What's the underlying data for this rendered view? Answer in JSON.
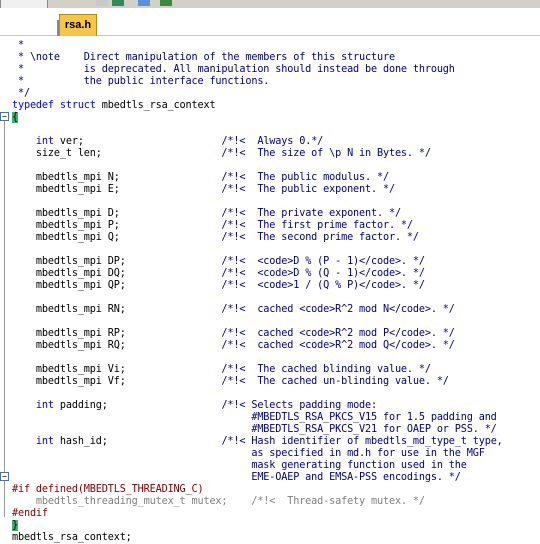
{
  "toolbar": {
    "icons": [
      "toolbar-icon-a",
      "download-arrow-icon",
      "filter-icon",
      "image-check-icon"
    ]
  },
  "tab": {
    "label": "rsa.h"
  },
  "code": {
    "lines": [
      {
        "text": " *",
        "cls": "c"
      },
      {
        "text": " * \\note    Direct manipulation of the members of this structure",
        "cls": "c"
      },
      {
        "text": " *          is deprecated. All manipulation should instead be done through",
        "cls": "c"
      },
      {
        "text": " *          the public interface functions.",
        "cls": "c"
      },
      {
        "text": " */",
        "cls": "c"
      },
      {
        "segments": [
          {
            "t": "typedef struct",
            "cls": "kw"
          },
          {
            "t": " mbedtls_rsa_context",
            "cls": ""
          }
        ]
      },
      {
        "text": "{",
        "cls": "brace"
      },
      {
        "text": "",
        "cls": ""
      },
      {
        "segments": [
          {
            "t": "    int",
            "cls": "kw"
          },
          {
            "t": " ver;                       ",
            "cls": ""
          },
          {
            "t": "/*!<  Always 0.*/",
            "cls": "c"
          }
        ]
      },
      {
        "segments": [
          {
            "t": "    size_t len;                    ",
            "cls": ""
          },
          {
            "t": "/*!<  The size of \\p N in Bytes. */",
            "cls": "c"
          }
        ]
      },
      {
        "text": "",
        "cls": ""
      },
      {
        "segments": [
          {
            "t": "    mbedtls_mpi N;                 ",
            "cls": ""
          },
          {
            "t": "/*!<  The public modulus. */",
            "cls": "c"
          }
        ]
      },
      {
        "segments": [
          {
            "t": "    mbedtls_mpi E;                 ",
            "cls": ""
          },
          {
            "t": "/*!<  The public exponent. */",
            "cls": "c"
          }
        ]
      },
      {
        "text": "",
        "cls": ""
      },
      {
        "segments": [
          {
            "t": "    mbedtls_mpi D;                 ",
            "cls": ""
          },
          {
            "t": "/*!<  The private exponent. */",
            "cls": "c"
          }
        ]
      },
      {
        "segments": [
          {
            "t": "    mbedtls_mpi P;                 ",
            "cls": ""
          },
          {
            "t": "/*!<  The first prime factor. */",
            "cls": "c"
          }
        ]
      },
      {
        "segments": [
          {
            "t": "    mbedtls_mpi Q;                 ",
            "cls": ""
          },
          {
            "t": "/*!<  The second prime factor. */",
            "cls": "c"
          }
        ]
      },
      {
        "text": "",
        "cls": ""
      },
      {
        "segments": [
          {
            "t": "    mbedtls_mpi DP;                ",
            "cls": ""
          },
          {
            "t": "/*!<  <code>D % (P - 1)</code>. */",
            "cls": "c"
          }
        ]
      },
      {
        "segments": [
          {
            "t": "    mbedtls_mpi DQ;                ",
            "cls": ""
          },
          {
            "t": "/*!<  <code>D % (Q - 1)</code>. */",
            "cls": "c"
          }
        ]
      },
      {
        "segments": [
          {
            "t": "    mbedtls_mpi QP;                ",
            "cls": ""
          },
          {
            "t": "/*!<  <code>1 / (Q % P)</code>. */",
            "cls": "c"
          }
        ]
      },
      {
        "text": "",
        "cls": ""
      },
      {
        "segments": [
          {
            "t": "    mbedtls_mpi RN;                ",
            "cls": ""
          },
          {
            "t": "/*!<  cached <code>R^2 mod N</code>. */",
            "cls": "c"
          }
        ]
      },
      {
        "text": "",
        "cls": ""
      },
      {
        "segments": [
          {
            "t": "    mbedtls_mpi RP;                ",
            "cls": ""
          },
          {
            "t": "/*!<  cached <code>R^2 mod P</code>. */",
            "cls": "c"
          }
        ]
      },
      {
        "segments": [
          {
            "t": "    mbedtls_mpi RQ;                ",
            "cls": ""
          },
          {
            "t": "/*!<  cached <code>R^2 mod Q</code>. */",
            "cls": "c"
          }
        ]
      },
      {
        "text": "",
        "cls": ""
      },
      {
        "segments": [
          {
            "t": "    mbedtls_mpi Vi;                ",
            "cls": ""
          },
          {
            "t": "/*!<  The cached blinding value. */",
            "cls": "c"
          }
        ]
      },
      {
        "segments": [
          {
            "t": "    mbedtls_mpi Vf;                ",
            "cls": ""
          },
          {
            "t": "/*!<  The cached un-blinding value. */",
            "cls": "c"
          }
        ]
      },
      {
        "text": "",
        "cls": ""
      },
      {
        "segments": [
          {
            "t": "    int",
            "cls": "kw"
          },
          {
            "t": " padding;                   ",
            "cls": ""
          },
          {
            "t": "/*!< Selects padding mode:",
            "cls": "c"
          }
        ]
      },
      {
        "text": "                                        #MBEDTLS_RSA_PKCS_V15 for 1.5 padding and",
        "cls": "c"
      },
      {
        "text": "                                        #MBEDTLS_RSA_PKCS_V21 for OAEP or PSS. */",
        "cls": "c"
      },
      {
        "segments": [
          {
            "t": "    int",
            "cls": "kw"
          },
          {
            "t": " hash_id;                   ",
            "cls": ""
          },
          {
            "t": "/*!< Hash identifier of mbedtls_md_type_t type,",
            "cls": "c"
          }
        ]
      },
      {
        "text": "                                        as specified in md.h for use in the MGF",
        "cls": "c"
      },
      {
        "text": "                                        mask generating function used in the",
        "cls": "c"
      },
      {
        "text": "                                        EME-OAEP and EMSA-PSS encodings. */",
        "cls": "c"
      },
      {
        "text": "#if defined(MBEDTLS_THREADING_C)",
        "cls": "pp"
      },
      {
        "text": "    mbedtls_threading_mutex_t mutex;    /*!<  Thread-safety mutex. */",
        "cls": "gray"
      },
      {
        "text": "#endif",
        "cls": "pp"
      },
      {
        "text": "}",
        "cls": "brace"
      },
      {
        "text": "mbedtls_rsa_context;",
        "cls": ""
      }
    ]
  }
}
